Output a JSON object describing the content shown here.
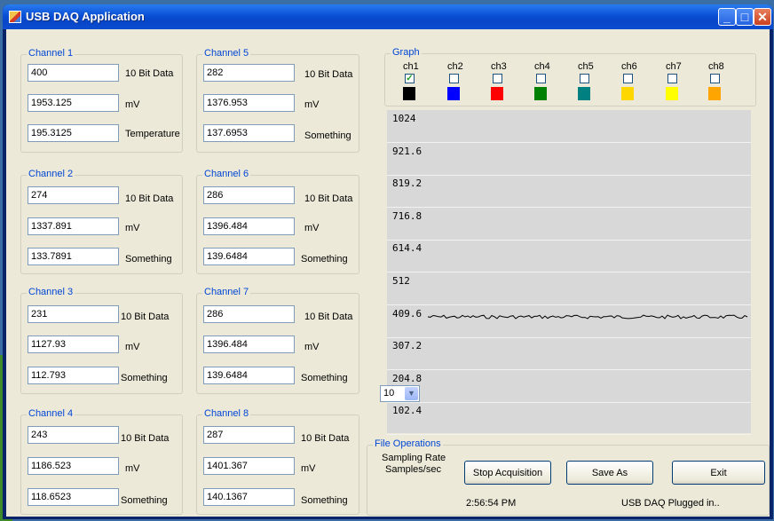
{
  "window": {
    "title": "USB DAQ Application"
  },
  "channels": [
    {
      "title": "Channel 1",
      "values": [
        "400",
        "1953.125",
        "195.3125"
      ],
      "labels": [
        "10 Bit Data",
        "mV",
        "Temperature"
      ]
    },
    {
      "title": "Channel 2",
      "values": [
        "274",
        "1337.891",
        "133.7891"
      ],
      "labels": [
        "10 Bit Data",
        "mV",
        "Something"
      ]
    },
    {
      "title": "Channel 3",
      "values": [
        "231",
        "1127.93",
        "112.793"
      ],
      "labels": [
        "10 Bit Data",
        "mV",
        "Something"
      ]
    },
    {
      "title": "Channel 4",
      "values": [
        "243",
        "1186.523",
        "118.6523"
      ],
      "labels": [
        "10 Bit Data",
        "mV",
        "Something"
      ]
    },
    {
      "title": "Channel 5",
      "values": [
        "282",
        "1376.953",
        "137.6953"
      ],
      "labels": [
        "10 Bit Data",
        "mV",
        "Something"
      ]
    },
    {
      "title": "Channel 6",
      "values": [
        "286",
        "1396.484",
        "139.6484"
      ],
      "labels": [
        "10 Bit Data",
        "mV",
        "Something"
      ]
    },
    {
      "title": "Channel 7",
      "values": [
        "286",
        "1396.484",
        "139.6484"
      ],
      "labels": [
        "10 Bit Data",
        "mV",
        "Something"
      ]
    },
    {
      "title": "Channel 8",
      "values": [
        "287",
        "1401.367",
        "140.1367"
      ],
      "labels": [
        "10 Bit Data",
        "mV",
        "Something"
      ]
    }
  ],
  "graph": {
    "title": "Graph",
    "channels": [
      {
        "label": "ch1",
        "checked": true,
        "color": "#000000"
      },
      {
        "label": "ch2",
        "checked": false,
        "color": "#0000ff"
      },
      {
        "label": "ch3",
        "checked": false,
        "color": "#ff0000"
      },
      {
        "label": "ch4",
        "checked": false,
        "color": "#008000"
      },
      {
        "label": "ch5",
        "checked": false,
        "color": "#008080"
      },
      {
        "label": "ch6",
        "checked": false,
        "color": "#ffd700"
      },
      {
        "label": "ch7",
        "checked": false,
        "color": "#ffff00"
      },
      {
        "label": "ch8",
        "checked": false,
        "color": "#ffa500"
      }
    ],
    "y_labels": [
      "1024",
      "921.6",
      "819.2",
      "716.8",
      "614.4",
      "512",
      "409.6",
      "307.2",
      "204.8",
      "102.4"
    ],
    "ch1_level": 400
  },
  "file_ops": {
    "title": "File Operations",
    "sampling_rate_label_1": "Sampling Rate",
    "sampling_rate_label_2": "Samples/sec",
    "sampling_rate_value": "10",
    "stop_label": "Stop Acquisition",
    "save_label": "Save As",
    "exit_label": "Exit",
    "time": "2:56:54 PM",
    "status": "USB DAQ Plugged in.."
  }
}
